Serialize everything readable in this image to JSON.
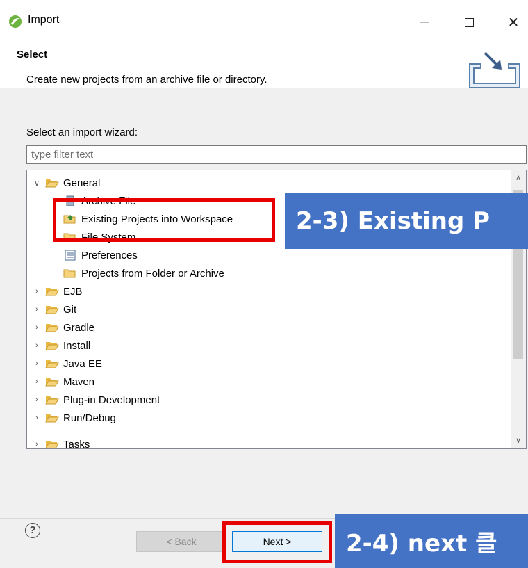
{
  "window": {
    "title": "Import"
  },
  "banner": {
    "title": "Select",
    "description": "Create new projects from an archive file or directory."
  },
  "wizard": {
    "label": "Select an import wizard:",
    "filter_placeholder": "type filter text"
  },
  "tree": {
    "items": [
      {
        "label": "General",
        "expanded": true,
        "icon": "folder-open-icon"
      },
      {
        "label": "Archive File",
        "icon": "archive-file-icon"
      },
      {
        "label": "Existing Projects into Workspace",
        "icon": "import-project-icon"
      },
      {
        "label": "File System",
        "icon": "folder-icon"
      },
      {
        "label": "Preferences",
        "icon": "preferences-icon"
      },
      {
        "label": "Projects from Folder or Archive",
        "icon": "folder-icon"
      },
      {
        "label": "EJB",
        "icon": "folder-open-icon"
      },
      {
        "label": "Git",
        "icon": "folder-open-icon"
      },
      {
        "label": "Gradle",
        "icon": "folder-open-icon"
      },
      {
        "label": "Install",
        "icon": "folder-open-icon"
      },
      {
        "label": "Java EE",
        "icon": "folder-open-icon"
      },
      {
        "label": "Maven",
        "icon": "folder-open-icon"
      },
      {
        "label": "Plug-in Development",
        "icon": "folder-open-icon"
      },
      {
        "label": "Run/Debug",
        "icon": "folder-open-icon"
      },
      {
        "label": "Tasks",
        "icon": "folder-open-icon"
      }
    ]
  },
  "buttons": {
    "help": "?",
    "back": "< Back",
    "next": "Next >"
  },
  "annotations": {
    "callout_1": "2-3) Existing P",
    "callout_2": "2-4) next 클"
  },
  "colors": {
    "highlight": "#e60000",
    "callout": "#4472c4",
    "folder": "#f0c75e"
  }
}
